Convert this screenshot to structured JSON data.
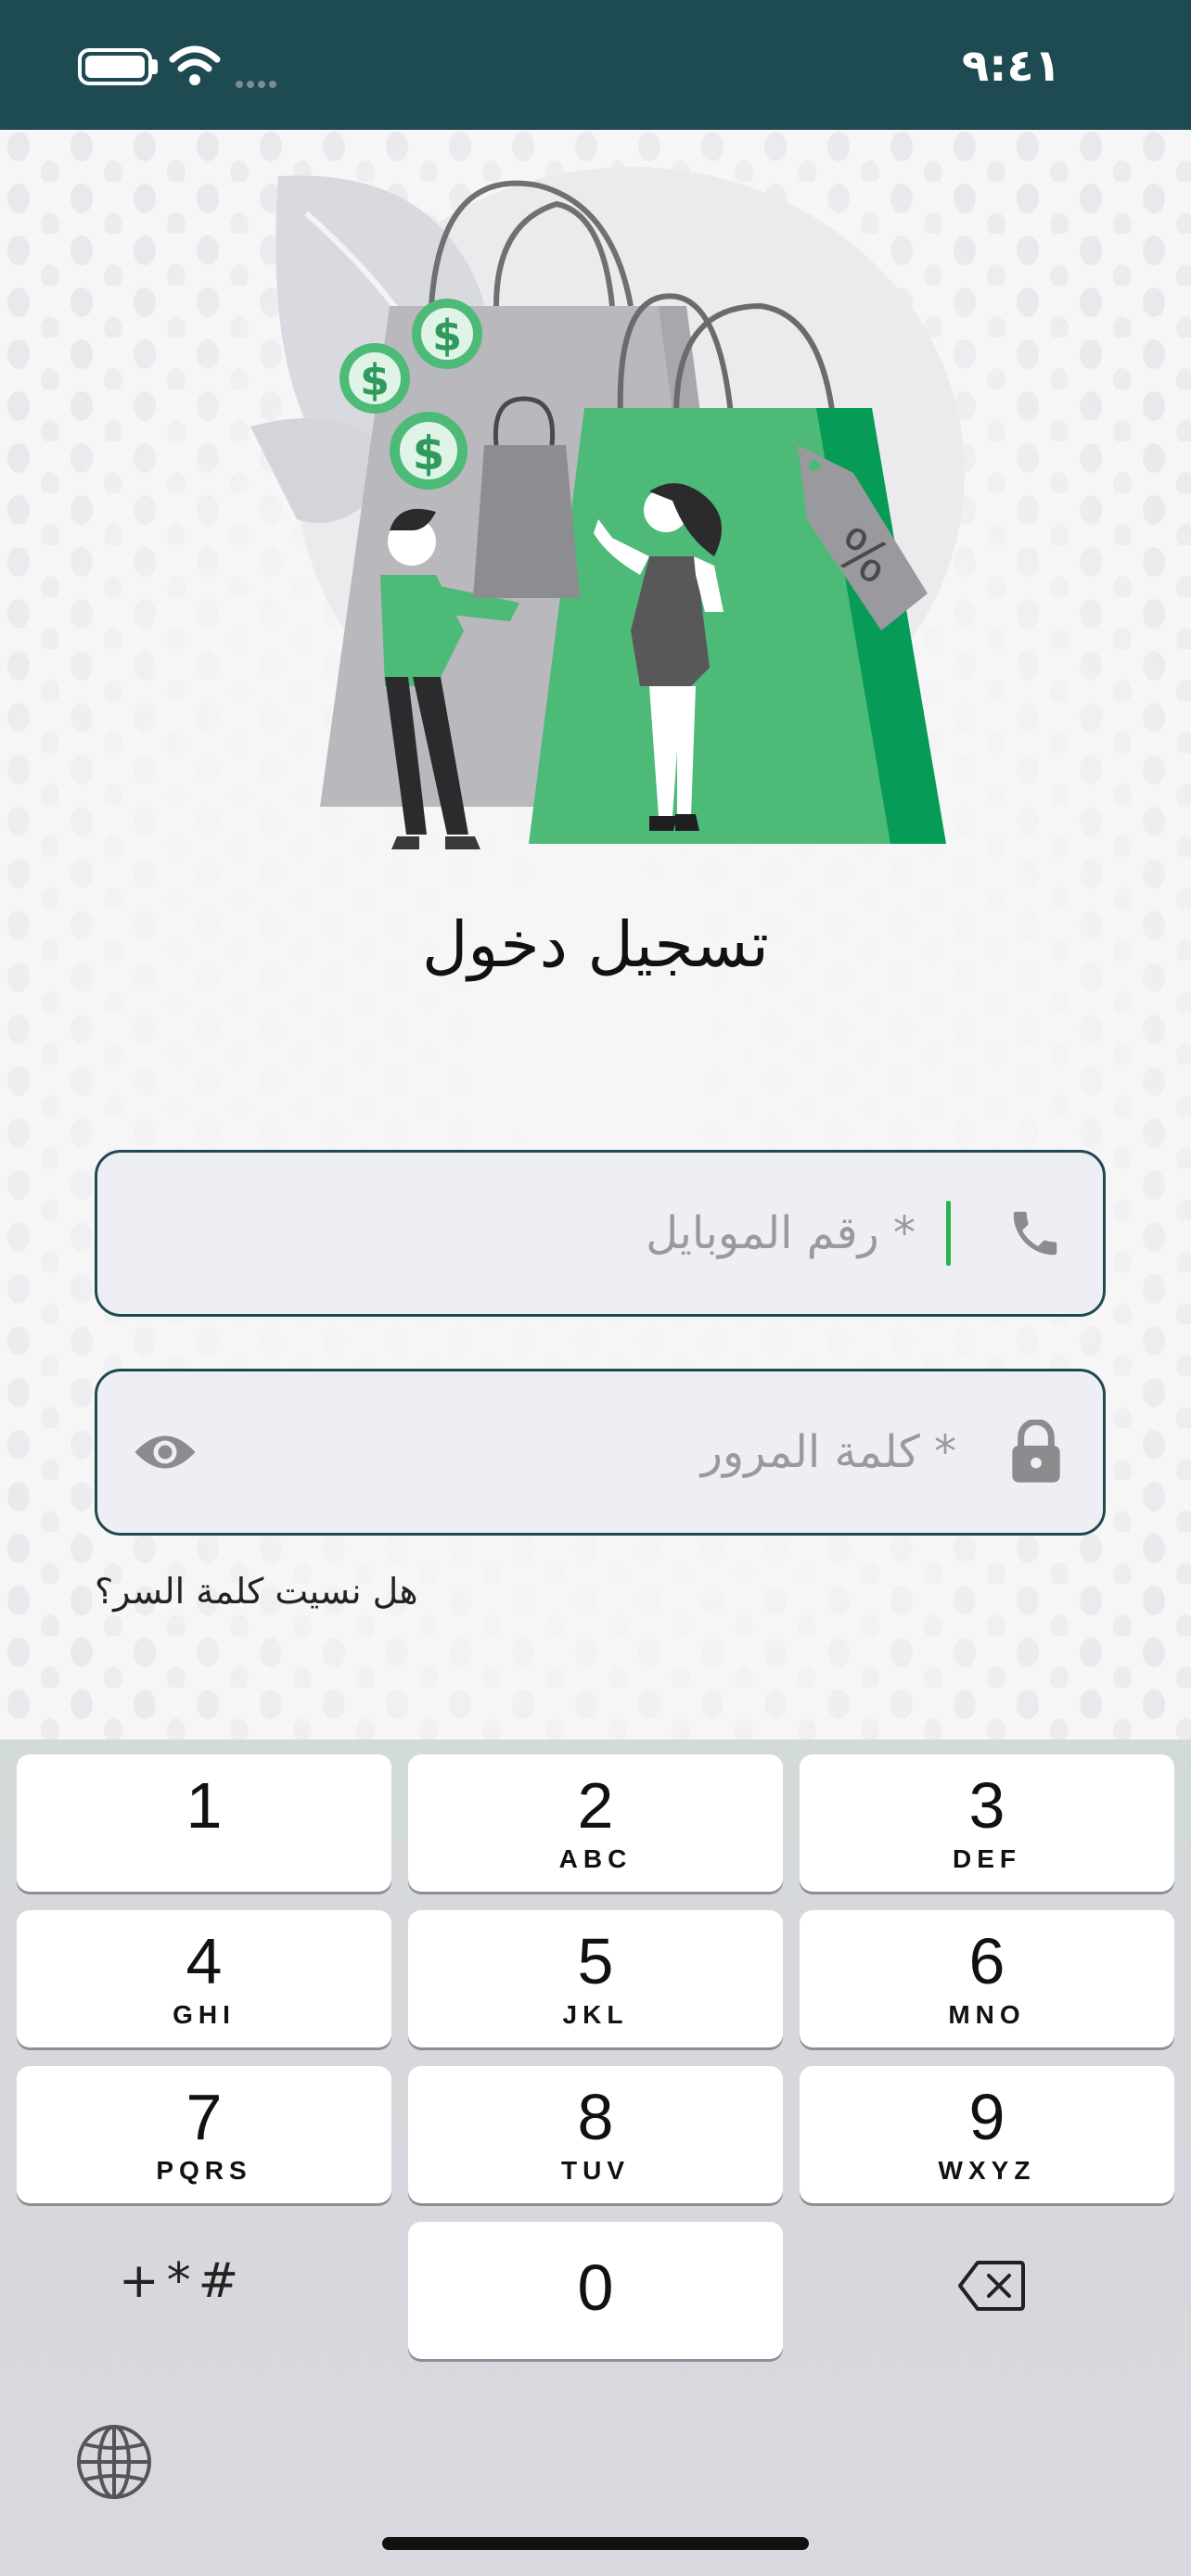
{
  "status_bar": {
    "time": "٩:٤١",
    "icons": [
      "battery-icon",
      "wifi-icon",
      "signal-dots-icon"
    ]
  },
  "login": {
    "title": "تسجيل دخول",
    "mobile_placeholder": "* رقم الموبايل",
    "password_placeholder": "* كلمة المرور",
    "forgot_password": "هل نسيت كلمة السر؟"
  },
  "keyboard": {
    "keys": [
      {
        "digit": "1",
        "letters": ""
      },
      {
        "digit": "2",
        "letters": "ABC"
      },
      {
        "digit": "3",
        "letters": "DEF"
      },
      {
        "digit": "4",
        "letters": "GHI"
      },
      {
        "digit": "5",
        "letters": "JKL"
      },
      {
        "digit": "6",
        "letters": "MNO"
      },
      {
        "digit": "7",
        "letters": "PQRS"
      },
      {
        "digit": "8",
        "letters": "TUV"
      },
      {
        "digit": "9",
        "letters": "WXYZ"
      },
      {
        "digit": "0",
        "letters": ""
      }
    ],
    "symbols_label": "+*#"
  },
  "colors": {
    "status_bar": "#1e4a52",
    "accent_green": "#4dba78",
    "field_border": "#1e4a52",
    "caret": "#2ab24a"
  }
}
